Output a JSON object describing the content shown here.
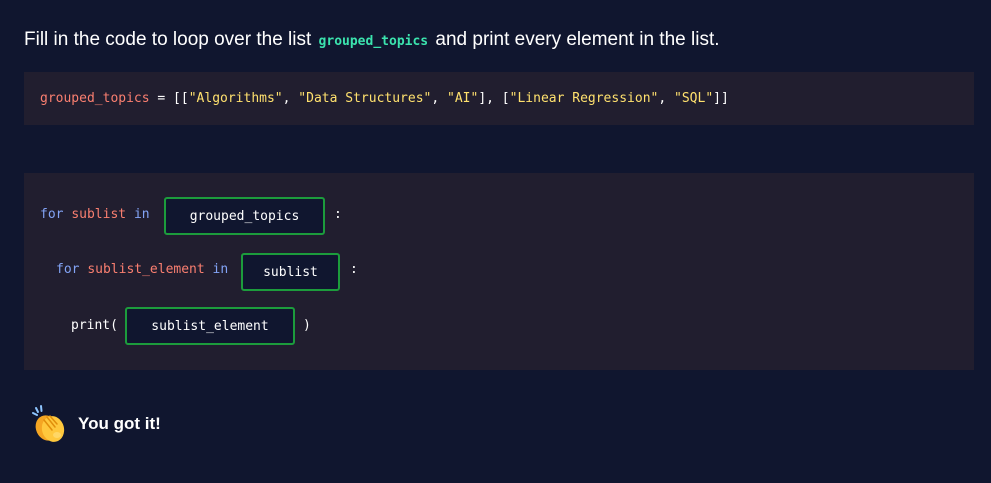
{
  "prompt": {
    "before": "Fill in the code to loop over the list",
    "code": "grouped_topics",
    "after": "and print every element in the list."
  },
  "given_code": {
    "var": "grouped_topics",
    "eq": " = [[",
    "s1": "\"Algorithms\"",
    "c1": ", ",
    "s2": "\"Data Structures\"",
    "c2": ", ",
    "s3": "\"AI\"",
    "c3": "], [",
    "s4": "\"Linear Regression\"",
    "c4": ", ",
    "s5": "\"SQL\"",
    "c5": "]]"
  },
  "fill_code": {
    "line1": {
      "kw1": "for",
      "var": "sublist",
      "kw2": "in",
      "blank": "grouped_topics",
      "colon": ":"
    },
    "line2": {
      "kw1": "for",
      "var": "sublist_element",
      "kw2": "in",
      "blank": "sublist",
      "colon": ":"
    },
    "line3": {
      "fn": "print(",
      "blank": "sublist_element",
      "close": ")"
    }
  },
  "feedback": {
    "icon": "clapping-hands-icon",
    "text": "You got it!"
  },
  "colors": {
    "background": "#10162f",
    "code_bg": "#211e2f",
    "keyword": "#83a4f6",
    "variable": "#fa7f70",
    "string": "#ffe16e",
    "inline_code": "#3be3ae",
    "blank_border": "#1c9c3c"
  }
}
